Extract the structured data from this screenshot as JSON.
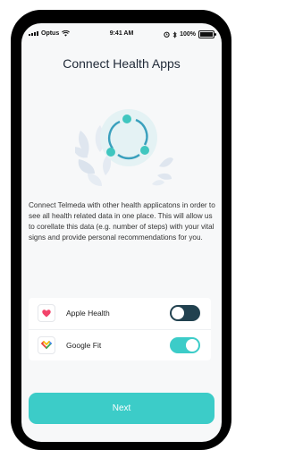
{
  "status_bar": {
    "carrier": "Optus",
    "time": "9:41 AM",
    "battery": "100%"
  },
  "page": {
    "title": "Connect Health Apps",
    "description": "Connect Telmeda with other health applicatons in order to see all health related data in one place. This will allow us to corellate this data (e.g. number of steps) with your vital signs and provide personal recommendations for you."
  },
  "apps": [
    {
      "name": "Apple Health",
      "enabled": false,
      "icon": "heart-icon"
    },
    {
      "name": "Google Fit",
      "enabled": true,
      "icon": "google-fit-icon"
    }
  ],
  "actions": {
    "next_label": "Next"
  },
  "colors": {
    "accent": "#3cccc8",
    "toggle_off": "#21414f",
    "title": "#1f2937"
  }
}
